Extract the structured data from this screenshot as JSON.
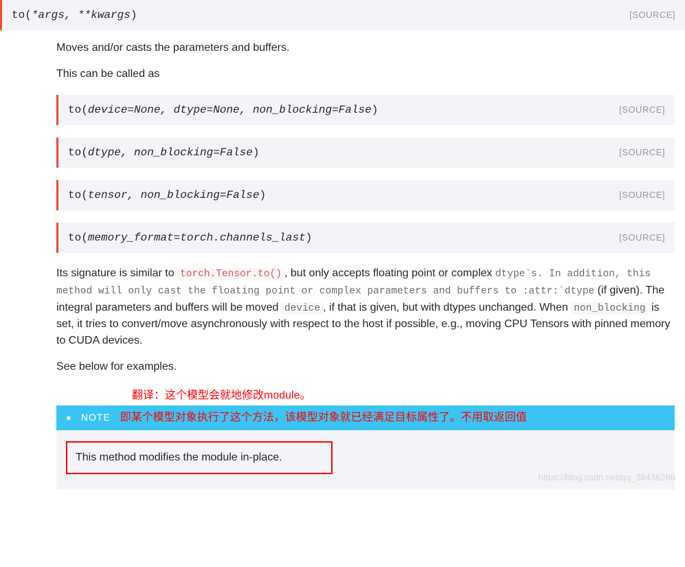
{
  "top_sig": {
    "fn": "to",
    "args": "*args, **kwargs",
    "source": "[SOURCE]"
  },
  "p1": "Moves and/or casts the parameters and buffers.",
  "p2": "This can be called as",
  "sigs": [
    {
      "fn": "to",
      "args": "device=None, dtype=None, non_blocking=False",
      "source": "[SOURCE]"
    },
    {
      "fn": "to",
      "args": "dtype, non_blocking=False",
      "source": "[SOURCE]"
    },
    {
      "fn": "to",
      "args": "tensor, non_blocking=False",
      "source": "[SOURCE]"
    },
    {
      "fn": "to",
      "args": "memory_format=torch.channels_last",
      "source": "[SOURCE]"
    }
  ],
  "p3": {
    "t1": "Its signature is similar to ",
    "c1": "torch.Tensor.to()",
    "t2": ", but only accepts floating point or complex ",
    "c2": "dtype`s. In addition, this method will only cast the floating point or complex parameters and buffers to :attr:`dtype",
    "t3": " (if given). The integral parameters and buffers will be moved ",
    "c3": "device",
    "t4": ", if that is given, but with dtypes unchanged. When ",
    "c4": "non_blocking",
    "t5": " is set, it tries to convert/move asynchronously with respect to the host if possible, e.g., moving CPU Tensors with pinned memory to CUDA devices."
  },
  "p4": "See below for examples.",
  "anno1": "翻译：这个模型会就地修改module。",
  "note": {
    "title": "NOTE",
    "anno2": "即某个模型对象执行了这个方法，该模型对象就已经满足目标属性了。不用取返回值",
    "body": "This method modifies the module in-place."
  },
  "watermark": "https://blog.csdn.net/qq_38436266"
}
